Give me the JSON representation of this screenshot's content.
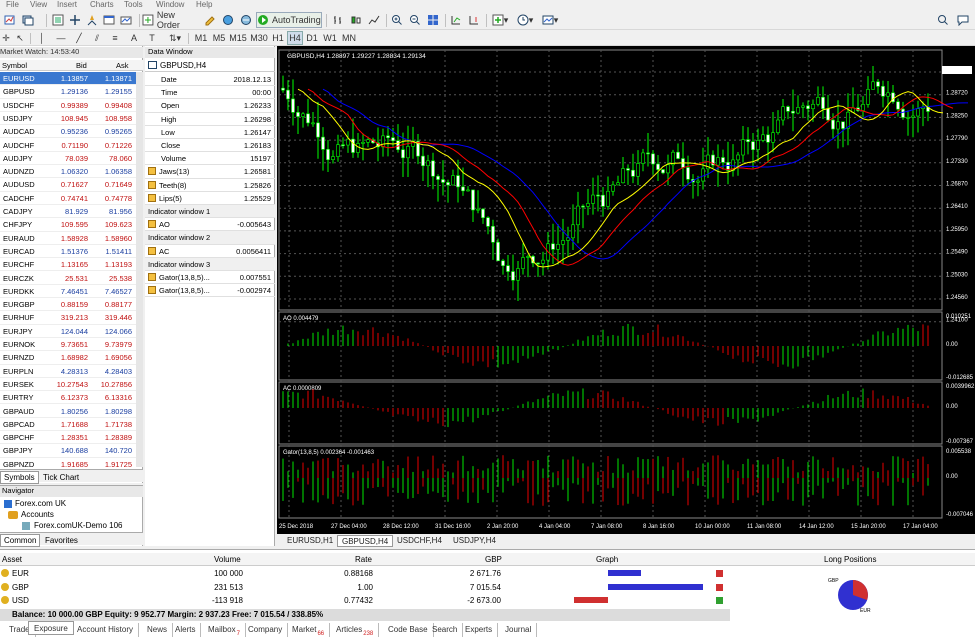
{
  "menu": [
    "File",
    "View",
    "Insert",
    "Charts",
    "Tools",
    "Window",
    "Help"
  ],
  "toolbar": {
    "new_order": "New Order",
    "autotrading": "AutoTrading",
    "timeframes": [
      "M1",
      "M5",
      "M15",
      "M30",
      "H1",
      "H4",
      "D1",
      "W1",
      "MN"
    ],
    "active_timeframe": "H4"
  },
  "market_watch": {
    "title": "Market Watch: 14:53:40",
    "headers": [
      "Symbol",
      "Bid",
      "Ask"
    ],
    "rows": [
      [
        "EURUSD",
        "1.13857",
        "1.13871"
      ],
      [
        "GBPUSD",
        "1.29136",
        "1.29155"
      ],
      [
        "USDCHF",
        "0.99389",
        "0.99408"
      ],
      [
        "USDJPY",
        "108.945",
        "108.958"
      ],
      [
        "AUDCAD",
        "0.95236",
        "0.95265"
      ],
      [
        "AUDCHF",
        "0.71190",
        "0.71226"
      ],
      [
        "AUDJPY",
        "78.039",
        "78.060"
      ],
      [
        "AUDNZD",
        "1.06320",
        "1.06358"
      ],
      [
        "AUDUSD",
        "0.71627",
        "0.71649"
      ],
      [
        "CADCHF",
        "0.74741",
        "0.74778"
      ],
      [
        "CADJPY",
        "81.929",
        "81.956"
      ],
      [
        "CHFJPY",
        "109.595",
        "109.623"
      ],
      [
        "EURAUD",
        "1.58928",
        "1.58960"
      ],
      [
        "EURCAD",
        "1.51376",
        "1.51411"
      ],
      [
        "EURCHF",
        "1.13165",
        "1.13193"
      ],
      [
        "EURCZK",
        "25.531",
        "25.538"
      ],
      [
        "EURDKK",
        "7.46451",
        "7.46527"
      ],
      [
        "EURGBP",
        "0.88159",
        "0.88177"
      ],
      [
        "EURHUF",
        "319.213",
        "319.446"
      ],
      [
        "EURJPY",
        "124.044",
        "124.066"
      ],
      [
        "EURNOK",
        "9.73651",
        "9.73979"
      ],
      [
        "EURNZD",
        "1.68982",
        "1.69056"
      ],
      [
        "EURPLN",
        "4.28313",
        "4.28403"
      ],
      [
        "EURSEK",
        "10.27543",
        "10.27856"
      ],
      [
        "EURTRY",
        "6.12373",
        "6.13316"
      ],
      [
        "GBPAUD",
        "1.80256",
        "1.80298"
      ],
      [
        "GBPCAD",
        "1.71688",
        "1.71738"
      ],
      [
        "GBPCHF",
        "1.28351",
        "1.28389"
      ],
      [
        "GBPJPY",
        "140.688",
        "140.720"
      ],
      [
        "GBPNZD",
        "1.91685",
        "1.91725"
      ]
    ],
    "tabs": [
      "Symbols",
      "Tick Chart"
    ]
  },
  "navigator": {
    "title": "Navigator",
    "items": [
      "Forex.com UK",
      "Accounts",
      "Forex.comUK-Demo 106"
    ],
    "tabs": [
      "Common",
      "Favorites"
    ]
  },
  "data_window": {
    "title": "Data Window",
    "symbol": "GBPUSD,H4",
    "rows": [
      [
        "Date",
        "2018.12.13"
      ],
      [
        "Time",
        "00:00"
      ],
      [
        "Open",
        "1.26233"
      ],
      [
        "High",
        "1.26298"
      ],
      [
        "Low",
        "1.26147"
      ],
      [
        "Close",
        "1.26183"
      ],
      [
        "Volume",
        "15197"
      ],
      [
        "Jaws(13)",
        "1.26581"
      ],
      [
        "Teeth(8)",
        "1.25826"
      ],
      [
        "Lips(5)",
        "1.25529"
      ],
      [
        "Indicator window 1",
        ""
      ],
      [
        "AO",
        "-0.005643"
      ],
      [
        "Indicator window 2",
        ""
      ],
      [
        "AC",
        "0.0056411"
      ],
      [
        "Indicator window 3",
        ""
      ],
      [
        "Gator(13,8,5)...",
        "0.007551"
      ],
      [
        "Gator(13,8,5)...",
        "-0.002974"
      ]
    ]
  },
  "chart": {
    "header": "GBPUSD,H4  1.28897 1.29227 1.28834 1.29134",
    "price_labels": [
      "1.29134",
      "1.28720",
      "1.28250",
      "1.27790",
      "1.27330",
      "1.26870",
      "1.26410",
      "1.25950",
      "1.25490",
      "1.25030",
      "1.24560",
      "1.24100"
    ],
    "ao_label": "AO 0.004479",
    "ao_scale": [
      "0.010251",
      "0.00",
      "-0.012685"
    ],
    "ac_label": "AC 0.0000809",
    "ac_scale": [
      "0.0039962",
      "0.00",
      "-0.007367"
    ],
    "gator_label": "Gator(13,8,5) 0.002364 -0.001463",
    "gator_scale": [
      "0.005538",
      "0.00",
      "-0.007046"
    ],
    "time_labels": [
      "25 Dec 2018",
      "27 Dec 04:00",
      "28 Dec 12:00",
      "31 Dec 16:00",
      "2 Jan 20:00",
      "4 Jan 04:00",
      "7 Jan 08:00",
      "8 Jan 16:00",
      "10 Jan 00:00",
      "11 Jan 08:00",
      "14 Jan 12:00",
      "15 Jan 20:00",
      "17 Jan 04:00"
    ],
    "colors": {
      "bull": "#00ff00",
      "bear": "#ffffff",
      "jaws": "#0000ff",
      "teeth": "#ff0000",
      "lips": "#ffff00",
      "ao_up": "#00c000",
      "ao_down": "#c00000",
      "grid": "#555555"
    }
  },
  "chart_tabs": [
    "EURUSD,H1",
    "GBPUSD,H4",
    "USDCHF,H4",
    "USDJPY,H4"
  ],
  "active_chart_tab": "GBPUSD,H4",
  "exposure": {
    "headers": [
      "Asset",
      "Volume",
      "Rate",
      "GBP",
      "Graph",
      "Long Positions"
    ],
    "rows": [
      [
        "EUR",
        "100 000",
        "0.88168",
        "2 671.76"
      ],
      [
        "GBP",
        "231 513",
        "1.00",
        "7 015.54"
      ],
      [
        "USD",
        "-113 918",
        "0.77432",
        "-2 673.00"
      ]
    ],
    "bars": [
      0.35,
      1.0,
      -0.36
    ],
    "bar_colors": [
      "#3030d0",
      "#3030d0",
      "#d03030"
    ],
    "pie_labels": [
      "GBP",
      "EUR"
    ],
    "balance": "Balance: 10 000.00 GBP  Equity: 9 952.77  Margin: 2 937.23  Free: 7 015.54 / 338.85%"
  },
  "bottom_tabs": [
    "Trade",
    "Exposure",
    "Account History",
    "News",
    "Alerts",
    "Mailbox",
    "Company",
    "Market",
    "Articles",
    "Code Base",
    "Search",
    "Experts",
    "Journal"
  ],
  "bottom_tab_badges": {
    "Mailbox": "7",
    "Market": "66",
    "Articles": "238"
  }
}
